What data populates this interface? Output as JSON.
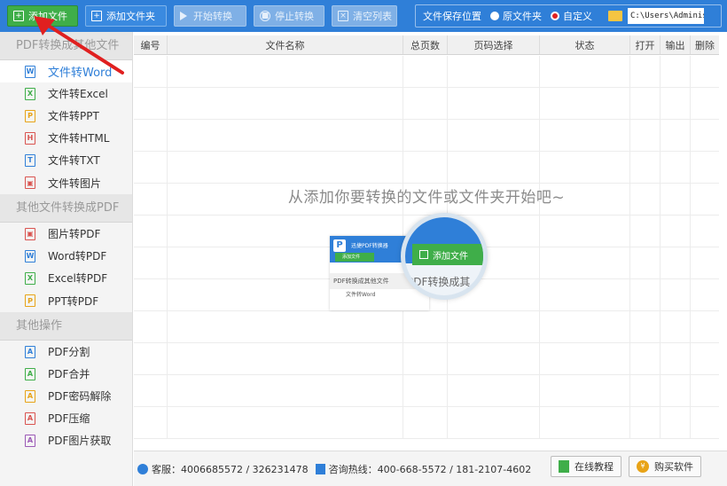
{
  "toolbar": {
    "add_file": "添加文件",
    "add_folder": "添加文件夹",
    "start": "开始转换",
    "stop": "停止转换",
    "clear": "清空列表",
    "save_location_label": "文件保存位置",
    "radio_original": "原文件夹",
    "radio_custom": "自定义",
    "save_path": "C:\\Users\\Adminis"
  },
  "sidebar": {
    "sections": [
      {
        "title": "PDF转换成其他文件",
        "items": [
          {
            "label": "文件转Word",
            "icon": "W"
          },
          {
            "label": "文件转Excel",
            "icon": "X"
          },
          {
            "label": "文件转PPT",
            "icon": "P"
          },
          {
            "label": "文件转HTML",
            "icon": "H"
          },
          {
            "label": "文件转TXT",
            "icon": "T"
          },
          {
            "label": "文件转图片",
            "icon": "▣"
          }
        ]
      },
      {
        "title": "其他文件转换成PDF",
        "items": [
          {
            "label": "图片转PDF",
            "icon": "▣"
          },
          {
            "label": "Word转PDF",
            "icon": "W"
          },
          {
            "label": "Excel转PDF",
            "icon": "X"
          },
          {
            "label": "PPT转PDF",
            "icon": "P"
          }
        ]
      },
      {
        "title": "其他操作",
        "items": [
          {
            "label": "PDF分割",
            "icon": "A"
          },
          {
            "label": "PDF合并",
            "icon": "A"
          },
          {
            "label": "PDF密码解除",
            "icon": "A"
          },
          {
            "label": "PDF压缩",
            "icon": "A"
          },
          {
            "label": "PDF图片获取",
            "icon": "A"
          }
        ]
      }
    ]
  },
  "table": {
    "headers": [
      "编号",
      "文件名称",
      "总页数",
      "页码选择",
      "状态",
      "打开",
      "输出",
      "删除"
    ]
  },
  "empty_hint": "从添加你要转换的文件或文件夹开始吧~",
  "illustration": {
    "app_title": "迅捷PDF转换器",
    "add_button": "添加文件",
    "section": "PDF转换成其他文件",
    "item": "文件转Word",
    "lens_text": "PDF转换成其"
  },
  "status": {
    "service": "客服：4006685572 / 326231478",
    "hotline": "咨询热线：400-668-5572 / 181-2107-4602",
    "tutorial": "在线教程",
    "buy": "购买软件"
  },
  "colors": {
    "toolbar": "#2f7fd8",
    "add_green": "#3fae49",
    "accent": "#2f7fd8",
    "arrow": "#e02020"
  }
}
